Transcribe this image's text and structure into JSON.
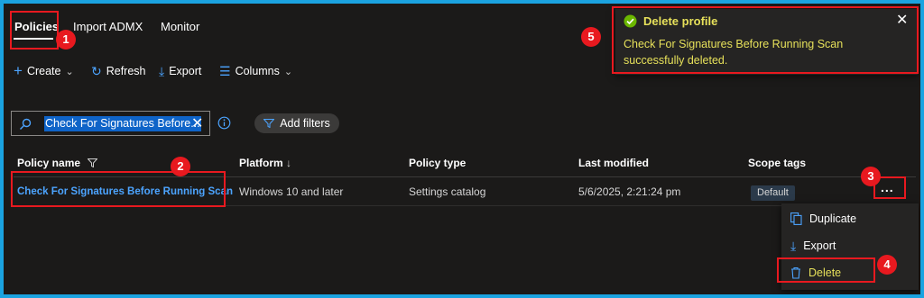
{
  "tabs": [
    {
      "label": "Policies",
      "active": true
    },
    {
      "label": "Import ADMX",
      "active": false
    },
    {
      "label": "Monitor",
      "active": false
    }
  ],
  "toolbar": {
    "create": "Create",
    "refresh": "Refresh",
    "export": "Export",
    "columns": "Columns"
  },
  "search": {
    "value": "Check For Signatures Before..."
  },
  "add_filters": "Add filters",
  "table": {
    "headers": [
      "Policy name",
      "Platform",
      "Policy type",
      "Last modified",
      "Scope tags"
    ],
    "rows": [
      {
        "policy_name": "Check For Signatures Before Running Scan",
        "platform": "Windows 10 and later",
        "policy_type": "Settings catalog",
        "last_modified": "5/6/2025, 2:21:24 pm",
        "scope_tag": "Default"
      }
    ]
  },
  "more_button": "...",
  "context_menu": {
    "items": [
      {
        "label": "Duplicate",
        "icon": "duplicate-icon"
      },
      {
        "label": "Export",
        "icon": "download-icon"
      },
      {
        "label": "Delete",
        "icon": "trash-icon"
      }
    ]
  },
  "toast": {
    "title": "Delete profile",
    "message": "Check For Signatures Before Running Scan successfully deleted."
  },
  "callouts": [
    "1",
    "2",
    "3",
    "4",
    "5"
  ],
  "colors": {
    "accent": "#4ca4ff",
    "highlight": "#e8191f",
    "toast_text": "#e6e05a",
    "success": "#6bb700"
  }
}
